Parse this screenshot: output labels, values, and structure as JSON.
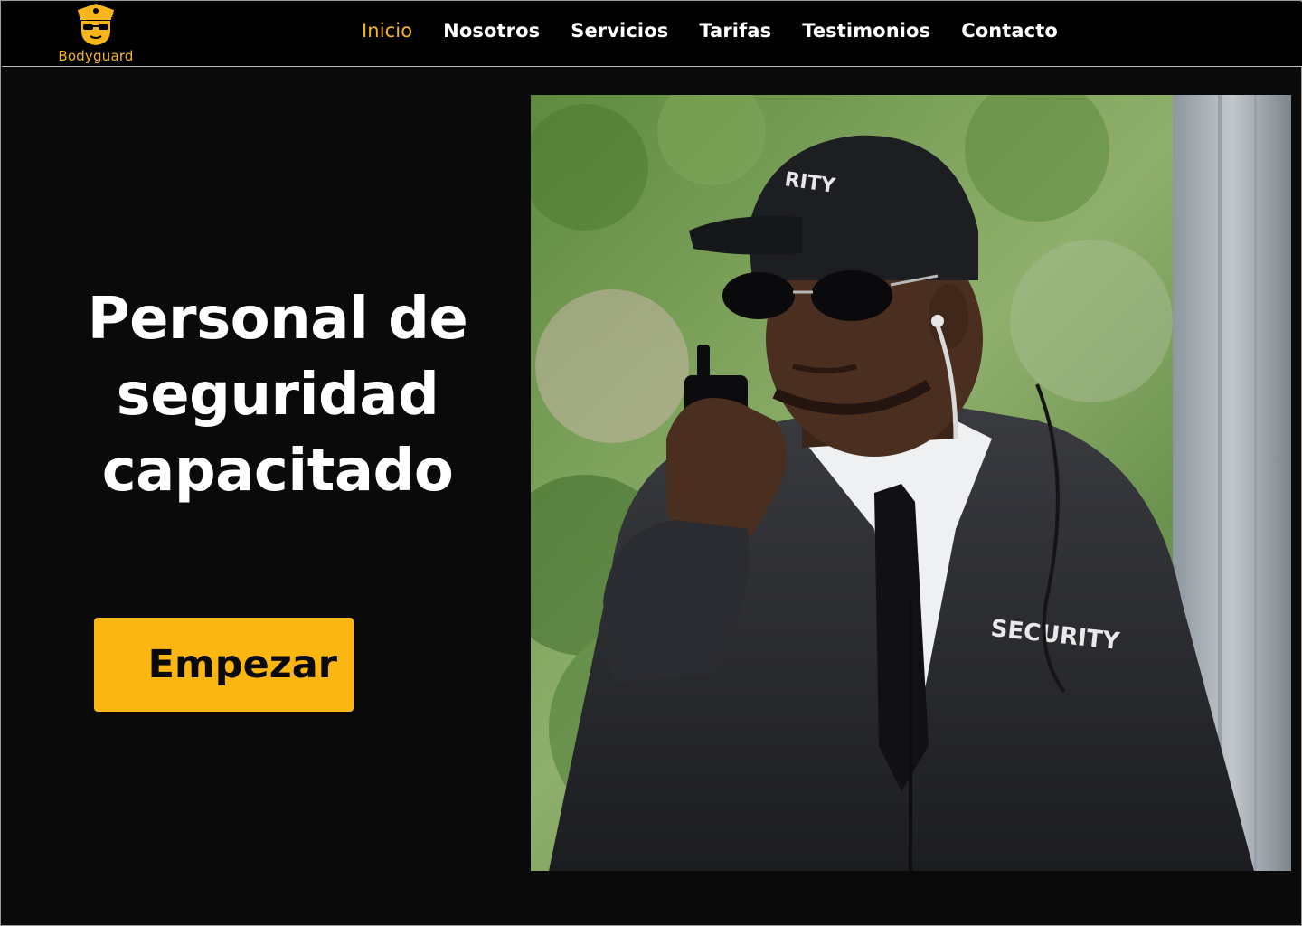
{
  "brand": {
    "name": "Bodyguard",
    "accent": "#f7b616"
  },
  "nav": {
    "items": [
      "Inicio",
      "Nosotros",
      "Servicios",
      "Tarifas",
      "Testimonios",
      "Contacto"
    ],
    "active": "Inicio"
  },
  "hero": {
    "headline_line1": "Personal de",
    "headline_line2": "seguridad",
    "headline_line3": "capacitado",
    "cta_label": "Empezar",
    "cta_color": "#fbb612",
    "photo": {
      "cap_text": "RITY",
      "jacket_text": "SECURITY"
    }
  },
  "colors": {
    "background": "#0b0a0b",
    "text": "#ffffff",
    "accent": "#f7b616"
  }
}
